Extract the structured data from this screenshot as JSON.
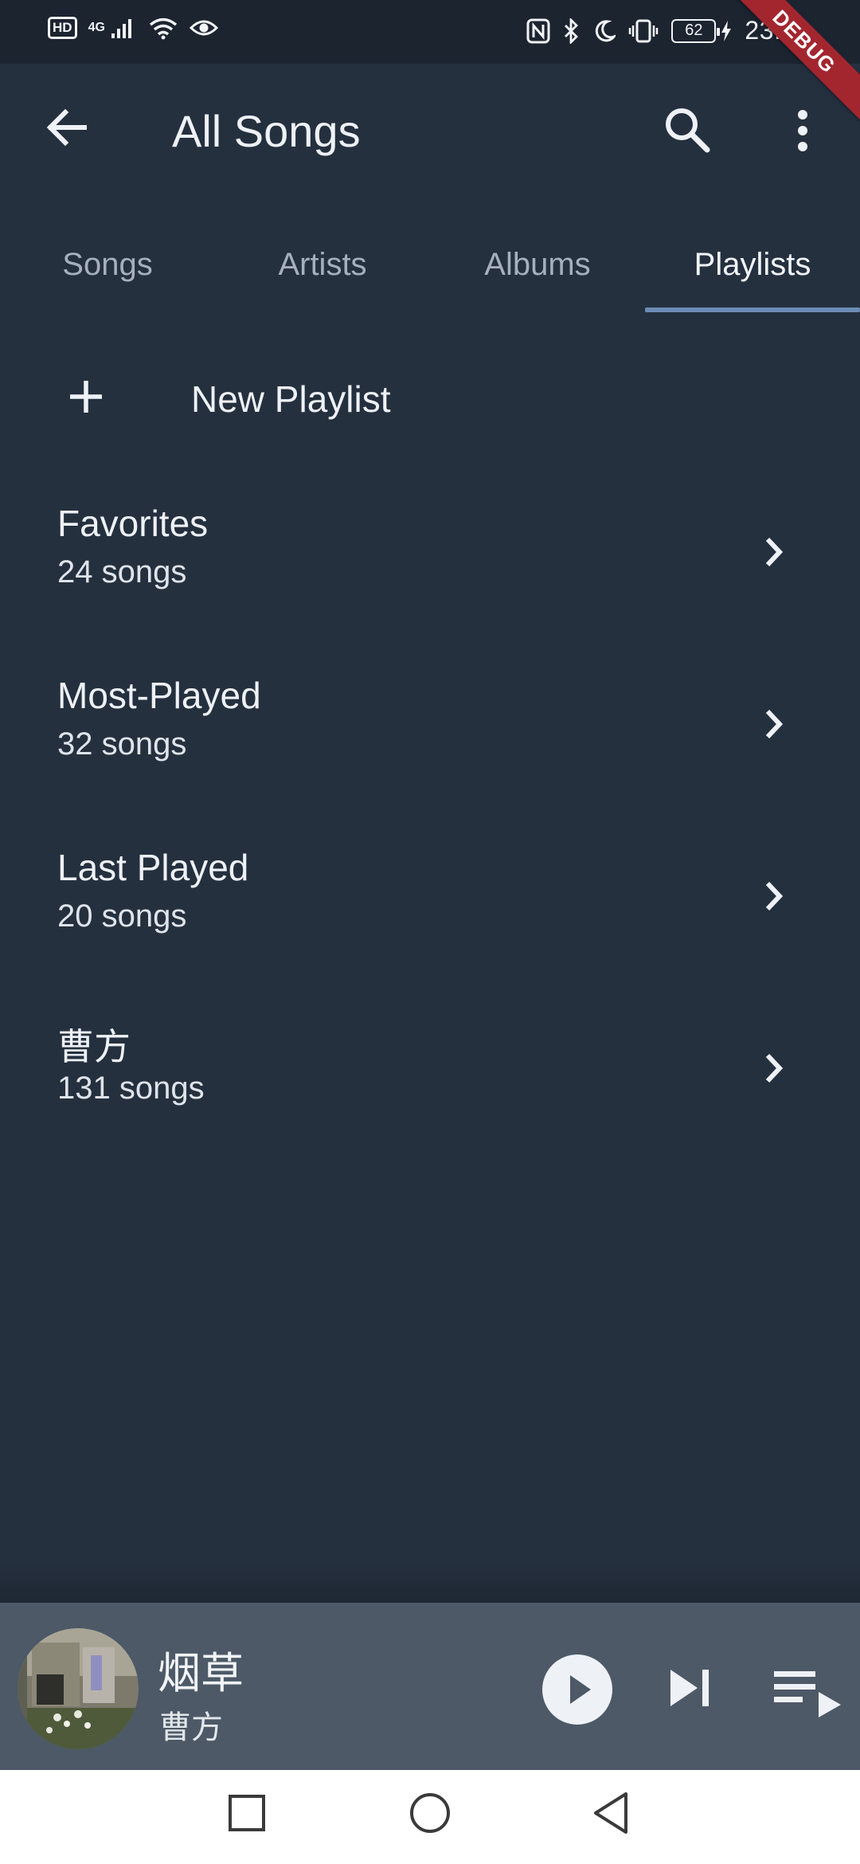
{
  "status_bar": {
    "hd": "HD",
    "network": "4G",
    "battery": "62",
    "time": "23:06"
  },
  "debug_banner": "DEBUG",
  "app_bar": {
    "title": "All Songs"
  },
  "tabs": [
    {
      "label": "Songs",
      "active": false
    },
    {
      "label": "Artists",
      "active": false
    },
    {
      "label": "Albums",
      "active": false
    },
    {
      "label": "Playlists",
      "active": true
    }
  ],
  "new_playlist": {
    "label": "New Playlist"
  },
  "playlists": [
    {
      "name": "Favorites",
      "count": "24 songs"
    },
    {
      "name": "Most-Played",
      "count": "32 songs"
    },
    {
      "name": "Last Played",
      "count": "20 songs"
    },
    {
      "name": "曹方",
      "count": "131 songs"
    }
  ],
  "mini_player": {
    "title": "烟草",
    "artist": "曹方"
  },
  "colors": {
    "background": "#25303f",
    "status_bar": "#1c2430",
    "tab_indicator": "#6c8cb4",
    "mini_player": "#4d5967",
    "debug_ribbon": "#a3262f"
  }
}
